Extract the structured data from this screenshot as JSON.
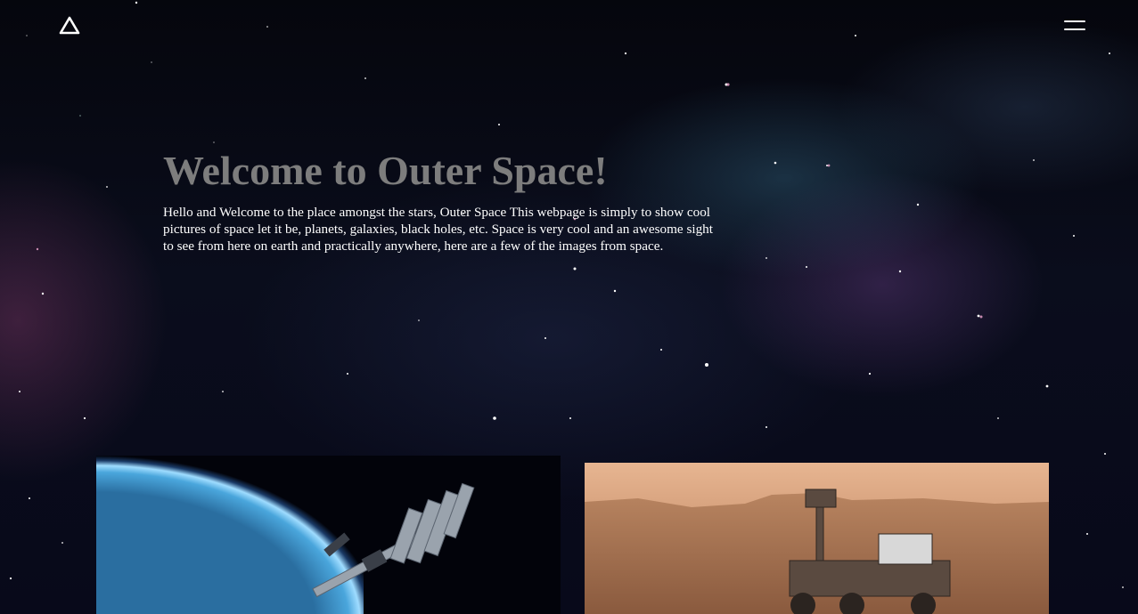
{
  "header": {
    "logo_icon": "triangle-logo-icon",
    "menu_icon": "hamburger-menu-icon"
  },
  "hero": {
    "title": "Welcome to Outer Space!",
    "description": "Hello and Welcome to the place amongst the stars, Outer Space This webpage is simply to show cool pictures of space let it be, planets, galaxies, black holes, etc. Space is very cool and an awesome sight to see from here on earth and practically anywhere, here are a few of the images from space."
  },
  "gallery": {
    "images": [
      {
        "subject": "international-space-station-over-earth"
      },
      {
        "subject": "mars-rover-selfie"
      }
    ]
  },
  "colors": {
    "title": "#7d7d7d",
    "text": "#ffffff",
    "background": "#05060d"
  }
}
